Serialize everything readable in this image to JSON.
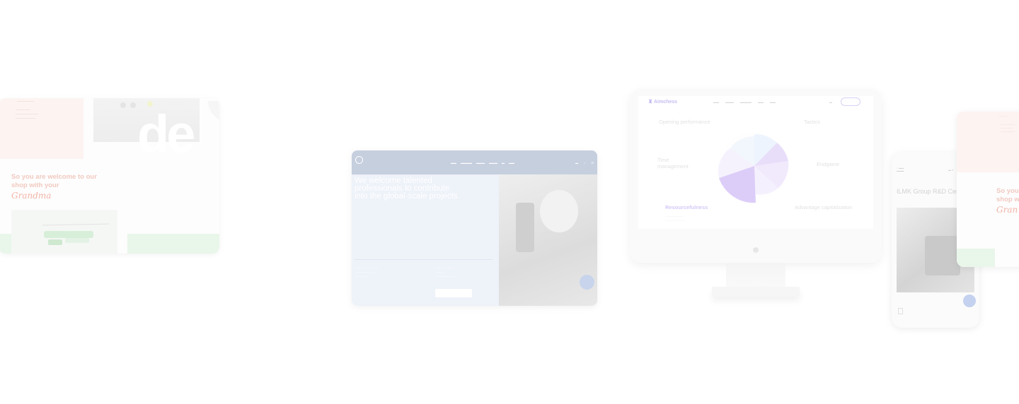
{
  "shop": {
    "headline_line1": "So you are welcome to our",
    "headline_line2": "shop with your",
    "script_word": "Grandma",
    "hero_letters": "de"
  },
  "careers": {
    "hero_title": "We welcome talented professionals to contribute into the global-scale projects"
  },
  "aimchess": {
    "brand": "Aimchess",
    "labels": {
      "opening": "Opening performance",
      "tactics": "Tactics",
      "time": "Time management",
      "endgame": "Endgame",
      "resourcefulness": "Resourcefulness",
      "advantage": "Advantage capitalization"
    }
  },
  "phone": {
    "title": "ILMK Group R&D Cen"
  },
  "shop2": {
    "headline_line1": "So you a",
    "headline_line2": "shop wit",
    "script_word": "Gran"
  }
}
